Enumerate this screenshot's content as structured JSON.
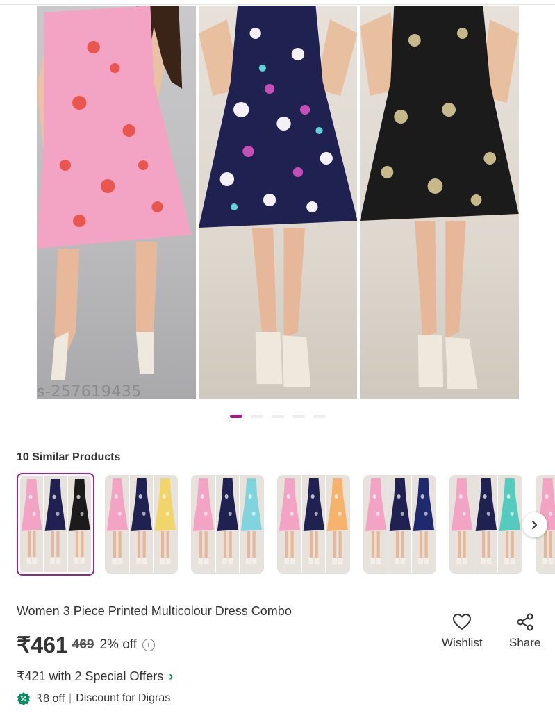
{
  "product_image": {
    "watermark": "s-257619435",
    "panels": [
      {
        "dress_color": "#f3a3c4",
        "print_color": "#e8564e"
      },
      {
        "dress_color": "#1f2150",
        "print_color": "#f4f0f6"
      },
      {
        "dress_color": "#1b1b1b",
        "print_color": "#c8b98a"
      }
    ],
    "carousel": {
      "count": 5,
      "active_index": 0
    }
  },
  "similar": {
    "title": "10 Similar Products",
    "thumbnails": [
      {
        "colors": [
          "#f3a3c4",
          "#1f2150",
          "#1b1b1b"
        ],
        "selected": true
      },
      {
        "colors": [
          "#f3a3c4",
          "#1f2150",
          "#f1d46a"
        ],
        "selected": false
      },
      {
        "colors": [
          "#f3a3c4",
          "#1f2150",
          "#7fd4de"
        ],
        "selected": false
      },
      {
        "colors": [
          "#f3a3c4",
          "#1f2150",
          "#f6b36b"
        ],
        "selected": false
      },
      {
        "colors": [
          "#f3a3c4",
          "#1f2150",
          "#1f2a6e"
        ],
        "selected": false
      },
      {
        "colors": [
          "#f3a3c4",
          "#1f2150",
          "#55cbc0"
        ],
        "selected": false
      },
      {
        "colors": [
          "#f3a3c4",
          "#1f2150",
          "#1b1b1b"
        ],
        "selected": false
      }
    ],
    "next_icon": "chevron-right-icon"
  },
  "product": {
    "title": "Women 3 Piece Printed Multicolour Dress Combo",
    "price": "₹461",
    "mrp": "469",
    "discount": "2% off",
    "offer_text": "₹421 with 2 Special Offers",
    "discount_line": "₹8 off",
    "discount_detail": "Discount for Digras"
  },
  "actions": {
    "wishlist_label": "Wishlist",
    "share_label": "Share"
  },
  "colors": {
    "accent": "#9f2089",
    "offer_green": "#038d63"
  }
}
